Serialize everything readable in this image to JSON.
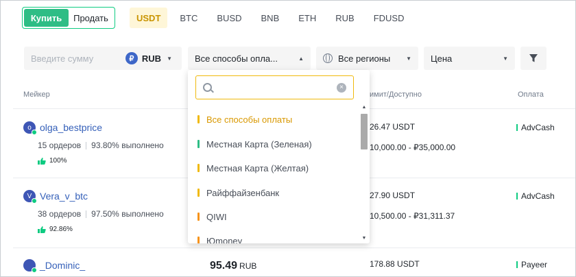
{
  "trade_toggle": {
    "buy": "Купить",
    "sell": "Продать"
  },
  "assets": [
    {
      "label": "USDT",
      "active": true
    },
    {
      "label": "BTC",
      "active": false
    },
    {
      "label": "BUSD",
      "active": false
    },
    {
      "label": "BNB",
      "active": false
    },
    {
      "label": "ETH",
      "active": false
    },
    {
      "label": "RUB",
      "active": false
    },
    {
      "label": "FDUSD",
      "active": false
    }
  ],
  "filters": {
    "amount_placeholder": "Введите сумму",
    "currency_symbol": "₽",
    "currency": "RUB",
    "payment": "Все способы оплa...",
    "region": "Все регионы",
    "price": "Цена"
  },
  "table": {
    "headers": {
      "maker": "Мейкер",
      "limit": "имит/Доступно",
      "payment": "Оплата"
    },
    "rows": [
      {
        "avatar": "o",
        "name": "olga_bestprice",
        "orders": "15 ордеров",
        "completion": "93.80% выполнено",
        "rating": "100%",
        "available": "26.47 USDT",
        "limit": "10,000.00 - ₽35,000.00",
        "payment": "AdvCash"
      },
      {
        "avatar": "V",
        "name": "Vera_v_btc",
        "orders": "38 ордеров",
        "completion": "97.50% выполнено",
        "rating": "92.86%",
        "available": "27.90 USDT",
        "limit": "10,500.00 - ₽31,311.37",
        "payment": "AdvCash"
      },
      {
        "avatar": "",
        "name": "_Dominic_",
        "price": "95.49",
        "price_unit": "RUB",
        "available": "178.88 USDT",
        "payment": "Payeer"
      }
    ]
  },
  "dropdown": {
    "search_value": "",
    "options": [
      {
        "label": "Все способы оплаты",
        "color": "#f0b90b",
        "selected": true
      },
      {
        "label": "Местная Карта (Зеленая)",
        "color": "#2ebd85",
        "selected": false
      },
      {
        "label": "Местная Карта (Желтая)",
        "color": "#f0b90b",
        "selected": false
      },
      {
        "label": "Райффайзенбанк",
        "color": "#f0b90b",
        "selected": false
      },
      {
        "label": "QIWI",
        "color": "#f7931a",
        "selected": false
      },
      {
        "label": "Юmoney",
        "color": "#f7931a",
        "selected": false
      }
    ]
  }
}
